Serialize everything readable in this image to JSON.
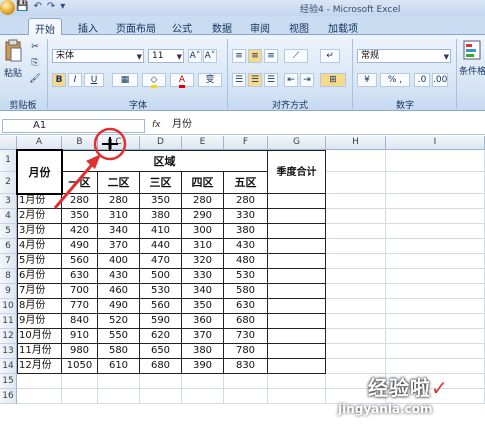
{
  "window": {
    "title": "经验4 - Microsoft Excel"
  },
  "qat": {
    "save": "💾",
    "undo": "↶",
    "redo": "↷",
    "more": "▾"
  },
  "tabs": [
    "开始",
    "插入",
    "页面布局",
    "公式",
    "数据",
    "审阅",
    "视图",
    "加载项"
  ],
  "ribbon": {
    "paste_label": "粘贴",
    "font_name": "宋体",
    "font_size": "11",
    "grow_font": "A˄",
    "shrink_font": "A˅",
    "bold": "B",
    "italic": "I",
    "underline": "U",
    "font_color_letter": "A",
    "phonetic": "变",
    "number_format": "常规",
    "number_buttons": "% ,",
    "conditional_format": "条件格",
    "groups": {
      "clipboard": "剪贴板",
      "font": "字体",
      "alignment": "对齐方式",
      "number": "数字"
    }
  },
  "formula_bar": {
    "name_box": "A1",
    "fx": "fx",
    "content": "月份"
  },
  "columns": [
    "A",
    "B",
    "C",
    "D",
    "E",
    "F",
    "G",
    "H",
    "I"
  ],
  "rows": [
    "1",
    "2",
    "3",
    "4",
    "5",
    "6",
    "7",
    "8",
    "9",
    "10",
    "11",
    "12",
    "13",
    "14",
    "15",
    "16"
  ],
  "sheet": {
    "header_month": "月份",
    "header_region": "区域",
    "header_total": "季度合计",
    "regions": [
      "一区",
      "二区",
      "三区",
      "四区",
      "五区"
    ],
    "months": [
      "1月份",
      "2月份",
      "3月份",
      "4月份",
      "5月份",
      "6月份",
      "7月份",
      "8月份",
      "9月份",
      "10月份",
      "11月份",
      "12月份"
    ],
    "values": [
      [
        280,
        280,
        350,
        280,
        280
      ],
      [
        350,
        310,
        380,
        290,
        330
      ],
      [
        420,
        340,
        410,
        300,
        380
      ],
      [
        490,
        370,
        440,
        310,
        430
      ],
      [
        560,
        400,
        470,
        320,
        480
      ],
      [
        630,
        430,
        500,
        330,
        530
      ],
      [
        700,
        460,
        530,
        340,
        580
      ],
      [
        770,
        490,
        560,
        350,
        630
      ],
      [
        840,
        520,
        590,
        360,
        680
      ],
      [
        910,
        550,
        620,
        370,
        730
      ],
      [
        980,
        580,
        650,
        380,
        780
      ],
      [
        1050,
        610,
        680,
        390,
        830
      ]
    ]
  },
  "watermark": {
    "line1": "经验啦",
    "check": "✓",
    "line2": "jingyanla.com"
  }
}
